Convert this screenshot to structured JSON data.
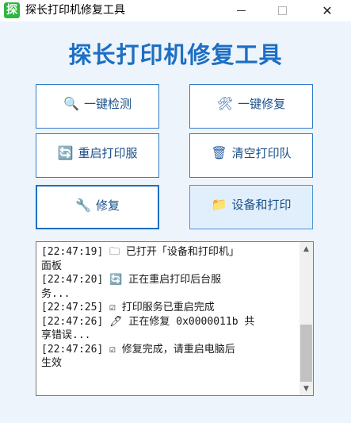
{
  "window": {
    "icon_glyph": "探",
    "title": "探长打印机修复工具",
    "min_icon": "minimize-icon",
    "max_icon": "maximize-icon",
    "close_glyph": "✕"
  },
  "header": {
    "title": "探长打印机修复工具"
  },
  "buttons": [
    {
      "icon": "search-icon",
      "glyph": "🔍",
      "label": "一键检测"
    },
    {
      "icon": "tools-icon",
      "glyph": "🛠",
      "label": "一键修复"
    },
    {
      "icon": "refresh-icon",
      "glyph": "🔄",
      "label": "重启打印服"
    },
    {
      "icon": "trash-icon",
      "glyph": "🗑",
      "label": "清空打印队"
    },
    {
      "icon": "wrench-icon",
      "glyph": "🔧",
      "label": "修复"
    },
    {
      "icon": "folder-icon",
      "glyph": "📁",
      "label": "设备和打印"
    }
  ],
  "log": {
    "lines": [
      "[22:47:19] 🗀  已打开「设备和打印机」",
      "面板",
      "[22:47:20] 🔄  正在重启打印后台服",
      "务...",
      "[22:47:25] ☑  打印服务已重启完成",
      "[22:47:26] 🖊  正在修复 0x0000011b 共",
      "享错误...",
      "[22:47:26] ☑  修复完成，请重启电脑后",
      "生效"
    ],
    "scroll_up": "▲",
    "scroll_down": "▼"
  },
  "colors": {
    "accent": "#1c6fc4",
    "button_border": "#2f7bc8",
    "app_icon_bg": "#2db83d",
    "background": "#eef4fb"
  }
}
